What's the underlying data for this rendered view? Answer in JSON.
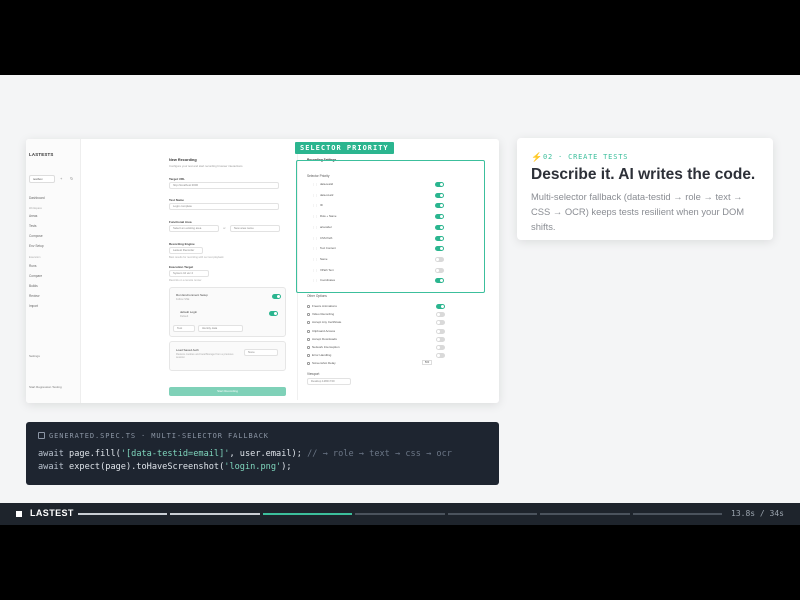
{
  "app": {
    "brand": "LASTESTS",
    "project_select": "testbox",
    "sidebar_items": [
      "Dashboard",
      "Areas",
      "Tests",
      "Compose",
      "Env Setup",
      "Runs",
      "Compare",
      "Builds",
      "Review",
      "Import"
    ],
    "sidebar_sections": [
      "Workspace",
      "Execution"
    ],
    "footer_settings": "Settings",
    "footer_user": "Start Regression Testing"
  },
  "recording": {
    "title": "New Recording",
    "subtitle": "Configure your test and start recording browser interactions",
    "target_url_label": "Target URL",
    "target_url_value": "http://localhost:3000",
    "test_name_label": "Test Name",
    "test_name_placeholder": "Login complete",
    "functional_area_label": "Functional Area",
    "functional_area_placeholder": "Select an existing area",
    "or_label": "or",
    "new_area_placeholder": "New area name",
    "engine_label": "Recording Engine",
    "engine_value": "Lastest Recorder",
    "engine_hint": "Best results for recording with our test playback",
    "exec_label": "Execution Target",
    "exec_value": "System 10 etc 2",
    "exec_hint": "Records on a remote runner",
    "env_setup_label": "Run Environment Setup",
    "env_setup_sub": "Follow SSE",
    "default_login_label": "default Login",
    "default_login_sub": "Default",
    "test_select": "Test",
    "ident_select": "Identity data",
    "load_auth_label": "Load Saved Auth",
    "load_auth_sub": "Restore cookies and localStorage from a previous session",
    "none_select": "None",
    "start_button": "Start Recording"
  },
  "settings": {
    "heading": "Recording Settings",
    "priority_heading": "Selector Priority",
    "selectors": [
      {
        "label": "data-testid",
        "on": true
      },
      {
        "label": "data-id-attr",
        "on": true
      },
      {
        "label": "ID",
        "on": true
      },
      {
        "label": "Role + Name",
        "on": true
      },
      {
        "label": "aria-label",
        "on": true
      },
      {
        "label": "CSS Path",
        "on": true
      },
      {
        "label": "Text Content",
        "on": true
      },
      {
        "label": "Name",
        "on": false
      },
      {
        "label": "XPath Text",
        "on": false
      },
      {
        "label": "Coordinates",
        "on": true
      }
    ],
    "other_heading": "Other Options",
    "options": [
      {
        "label": "Freeze Animations",
        "on": true
      },
      {
        "label": "Video Recording",
        "on": false
      },
      {
        "label": "Accept Any Certificate",
        "on": false
      },
      {
        "label": "Clipboard Access",
        "on": false
      },
      {
        "label": "Accept Downloads",
        "on": false
      },
      {
        "label": "Network Interception",
        "on": false
      },
      {
        "label": "Error Handling",
        "on": false
      },
      {
        "label": "Screenshot Delay",
        "on": false
      }
    ],
    "screenshot_delay_value": "500",
    "viewport_label": "Viewport",
    "viewport_value": "Desktop 1280×720"
  },
  "highlight_tag": "SELECTOR PRIORITY",
  "step": {
    "label": "02 · CREATE TESTS",
    "title": "Describe it. AI writes the code.",
    "description": "Multi-selector fallback (data-testid → role → text → CSS → OCR) keeps tests resilient when your DOM shifts."
  },
  "code": {
    "label": "GENERATED.SPEC.TS · MULTI-SELECTOR FALLBACK",
    "line1": {
      "await1": "await",
      "call1": " page.fill(",
      "str1": "'[data-testid=email]'",
      "rest1": ", user.email);",
      "comment": " // → role → text → css → ocr"
    },
    "line2": {
      "await2": "await",
      "call2": " expect(page).toHaveScreenshot(",
      "str2": "'login.png'",
      "rest2": ");"
    }
  },
  "bottom_bar": {
    "logo": "LASTEST",
    "time": "13.8s / 34s",
    "segments_done": 2,
    "segments_active": 1,
    "segments_total": 7
  }
}
